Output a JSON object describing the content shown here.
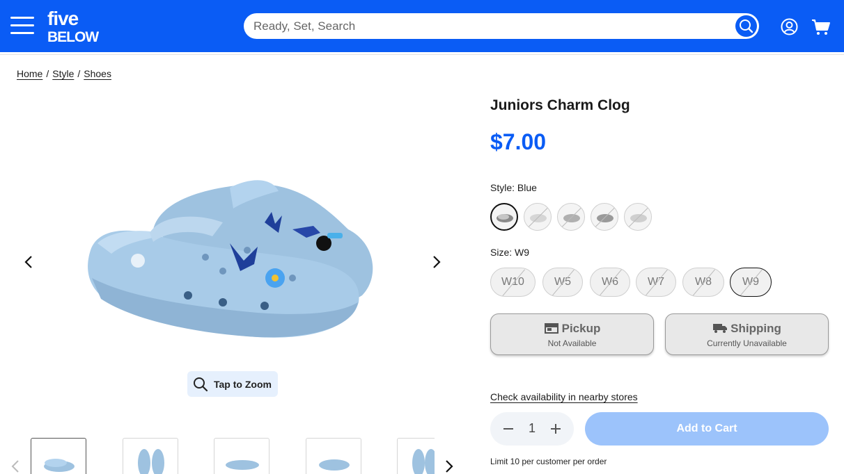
{
  "header": {
    "logo_text": [
      "five",
      "BELOW"
    ],
    "search_placeholder": "Ready, Set, Search",
    "brand_color": "#0a5cf5",
    "icons": [
      "menu-icon",
      "search-icon",
      "account-icon",
      "cart-icon"
    ]
  },
  "breadcrumb": [
    {
      "label": "Home"
    },
    {
      "label": "Style"
    },
    {
      "label": "Shoes"
    }
  ],
  "gallery": {
    "zoom_label": "Tap to Zoom",
    "thumbnail_count": 5
  },
  "product": {
    "title": "Juniors Charm Clog",
    "price": "$7.00",
    "style_prefix": "Style: ",
    "style_value": "Blue",
    "size_prefix": "Size: ",
    "size_value": "W9",
    "swatch_count": 5,
    "sizes": [
      "W10",
      "W5",
      "W6",
      "W7",
      "W8",
      "W9"
    ],
    "selected_size": "W9",
    "pickup": {
      "title": "Pickup",
      "status": "Not Available"
    },
    "shipping": {
      "title": "Shipping",
      "status": "Currently Unavailable"
    },
    "check_availability": "Check availability in nearby stores",
    "quantity": "1",
    "add_to_cart": "Add to Cart",
    "limit_text": "Limit 10 per customer per order"
  }
}
